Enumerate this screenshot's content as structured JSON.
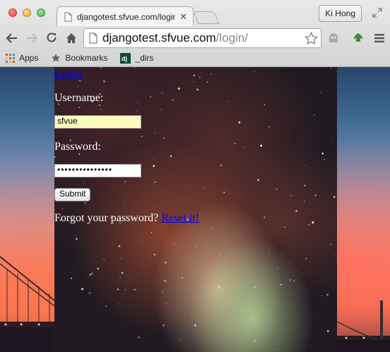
{
  "browser": {
    "tab": {
      "title": "djangotest.sfvue.com/login/"
    },
    "profile_name": "Ki Hong",
    "address": {
      "host": "djangotest.sfvue.com",
      "path": "/login/"
    },
    "bookmarks": [
      "Apps",
      "Bookmarks",
      "_dirs"
    ]
  },
  "page": {
    "login_link": "Login",
    "username_label": "Username:",
    "username_value": "sfvue",
    "password_label": "Password:",
    "password_masked": "•••••••••••••••",
    "submit_label": "Submit",
    "forgot_text": "Forgot your password?",
    "reset_link": "Reset it!"
  },
  "colors": {
    "link": "#0000ee",
    "username_field_bg": "#fafcbf",
    "chrome_bg": "#dcdcdc"
  }
}
